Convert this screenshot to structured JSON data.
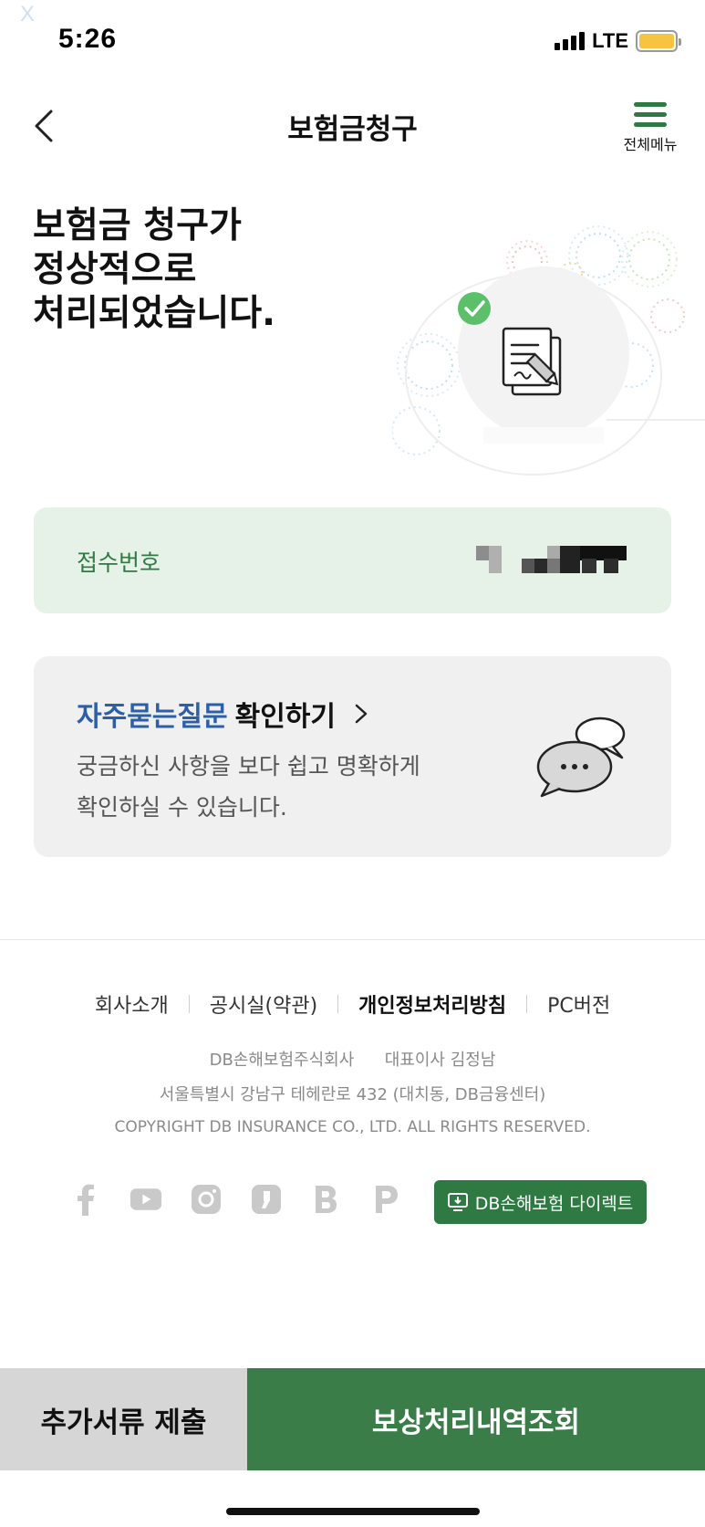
{
  "status_bar": {
    "close_mark": "X",
    "time": "5:26",
    "network": "LTE"
  },
  "header": {
    "title": "보험금청구",
    "menu_label": "전체메뉴"
  },
  "hero": {
    "line1": "보험금 청구가",
    "line2": "정상적으로",
    "line3": "처리되었습니다."
  },
  "receipt": {
    "label": "접수번호"
  },
  "faq": {
    "title_highlight": "자주묻는질문",
    "title_rest": "확인하기",
    "chevron": "›",
    "desc_line1": "궁금하신 사항을 보다 쉽고 명확하게",
    "desc_line2": "확인하실 수 있습니다."
  },
  "footer": {
    "links": [
      "회사소개",
      "공시실(약관)",
      "개인정보처리방침",
      "PC버전"
    ],
    "company": "DB손해보험주식회사",
    "ceo": "대표이사 김정남",
    "address": "서울특별시 강남구 테헤란로 432 (대치동, DB금융센터)",
    "copyright": "COPYRIGHT DB INSURANCE CO., LTD. ALL RIGHTS RESERVED.",
    "social_icons": [
      "facebook-icon",
      "youtube-icon",
      "instagram-icon",
      "kakao-story-icon",
      "blog-icon",
      "post-icon"
    ],
    "direct_button": "DB손해보험 다이렉트"
  },
  "bottom": {
    "left_button": "추가서류 제출",
    "right_button": "보상처리내역조회"
  },
  "colors": {
    "brand_green": "#2f7a43",
    "highlight_blue": "#2d5fa8",
    "receipt_bg": "#e6f2e8"
  }
}
